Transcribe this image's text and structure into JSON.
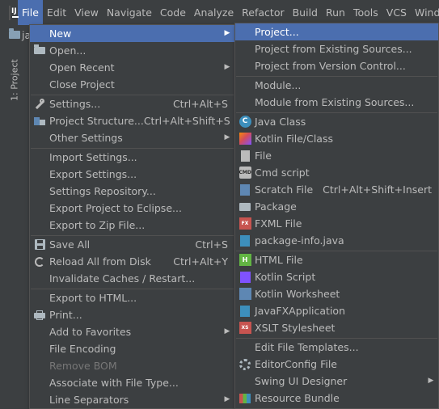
{
  "menubar": {
    "items": [
      "File",
      "Edit",
      "View",
      "Navigate",
      "Code",
      "Analyze",
      "Refactor",
      "Build",
      "Run",
      "Tools",
      "VCS",
      "Window"
    ]
  },
  "project_strip": {
    "name": "ja",
    "tab_label": "1: Project"
  },
  "file_menu": {
    "new": "New",
    "open": "Open...",
    "open_recent": "Open Recent",
    "close_project": "Close Project",
    "settings": "Settings...",
    "settings_shortcut": "Ctrl+Alt+S",
    "project_structure": "Project Structure...",
    "project_structure_shortcut": "Ctrl+Alt+Shift+S",
    "other_settings": "Other Settings",
    "import_settings": "Import Settings...",
    "export_settings": "Export Settings...",
    "settings_repository": "Settings Repository...",
    "export_eclipse": "Export Project to Eclipse...",
    "export_zip": "Export to Zip File...",
    "save_all": "Save All",
    "save_all_shortcut": "Ctrl+S",
    "reload_disk": "Reload All from Disk",
    "reload_disk_shortcut": "Ctrl+Alt+Y",
    "invalidate_caches": "Invalidate Caches / Restart...",
    "export_html": "Export to HTML...",
    "print": "Print...",
    "add_favorites": "Add to Favorites",
    "file_encoding": "File Encoding",
    "remove_bom": "Remove BOM",
    "associate_file_type": "Associate with File Type...",
    "line_separators": "Line Separators"
  },
  "new_menu": {
    "project": "Project...",
    "project_existing": "Project from Existing Sources...",
    "project_vcs": "Project from Version Control...",
    "module": "Module...",
    "module_existing": "Module from Existing Sources...",
    "java_class": "Java Class",
    "kotlin_file_class": "Kotlin File/Class",
    "file": "File",
    "cmd_script": "Cmd script",
    "scratch_file": "Scratch File",
    "scratch_file_shortcut": "Ctrl+Alt+Shift+Insert",
    "package": "Package",
    "fxml_file": "FXML File",
    "package_info": "package-info.java",
    "html_file": "HTML File",
    "kotlin_script": "Kotlin Script",
    "kotlin_worksheet": "Kotlin Worksheet",
    "javafx_application": "JavaFXApplication",
    "xslt_stylesheet": "XSLT Stylesheet",
    "edit_file_templates": "Edit File Templates...",
    "editorconfig_file": "EditorConfig File",
    "swing_ui_designer": "Swing UI Designer",
    "resource_bundle": "Resource Bundle"
  },
  "colors": {
    "selection": "#4b6eaf",
    "menu_bg": "#3c3f41",
    "text": "#bbbbbb",
    "disabled": "#777777"
  }
}
